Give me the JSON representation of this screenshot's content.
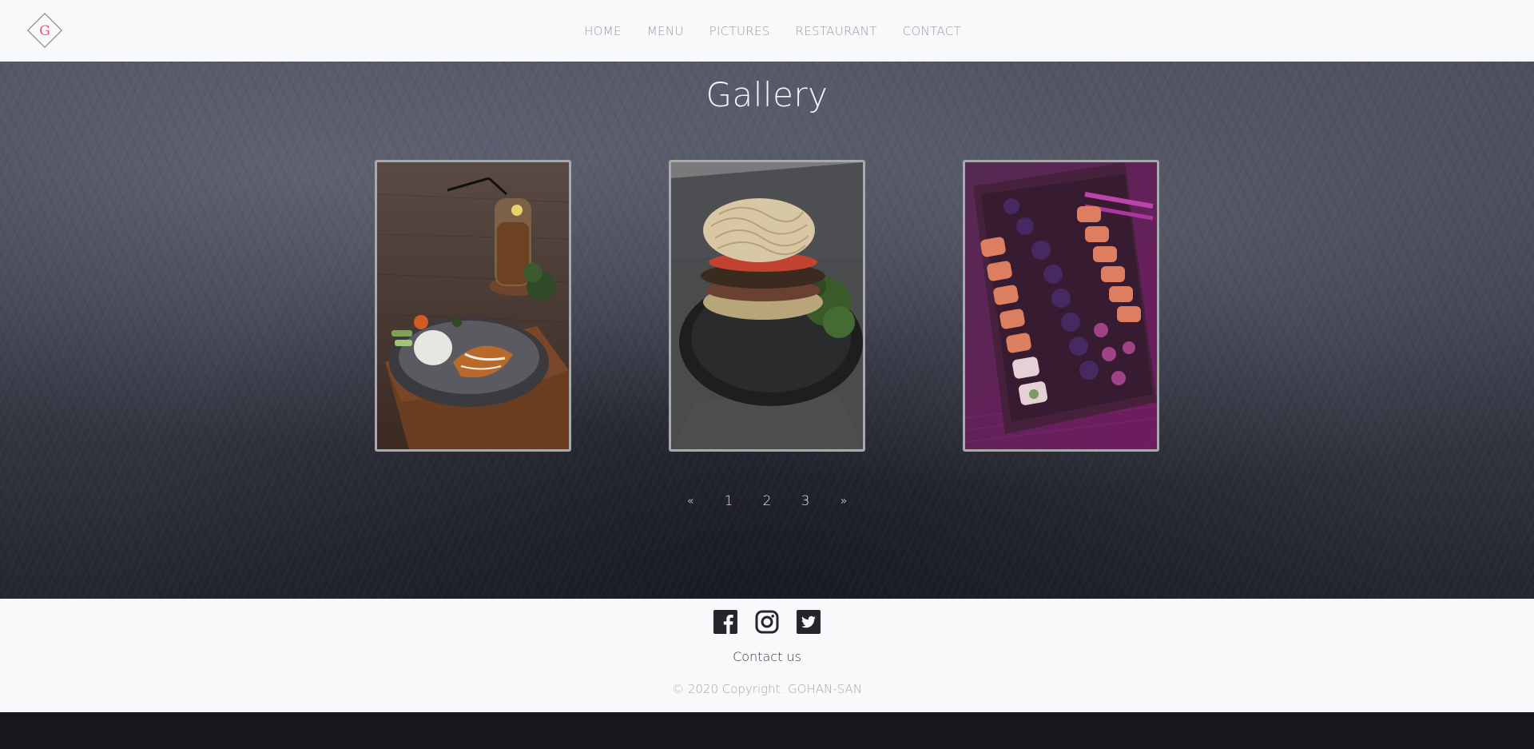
{
  "header": {
    "logo_letter": "G",
    "nav": [
      "HOME",
      "MENU",
      "PICTURES",
      "RESTAURANT",
      "CONTACT"
    ]
  },
  "gallery": {
    "title": "Gallery",
    "photos": [
      {
        "subject": "rice plate with iced tea"
      },
      {
        "subject": "noodle bun burger"
      },
      {
        "subject": "sushi rolls"
      }
    ]
  },
  "pagination": {
    "prev": "«",
    "pages": [
      "1",
      "2",
      "3"
    ],
    "next": "»",
    "active": "1"
  },
  "footer": {
    "social_icons": [
      "facebook-icon",
      "instagram-icon",
      "twitter-icon"
    ],
    "contact": "Contact us",
    "copyright": "© 2020 Copyright. GOHAN-SAN"
  },
  "colors": {
    "accent": "#e0527a",
    "header_bg": "#f8f9fa",
    "nav_text": "#9a9ca3",
    "photo_border": "#a9a9ad"
  }
}
